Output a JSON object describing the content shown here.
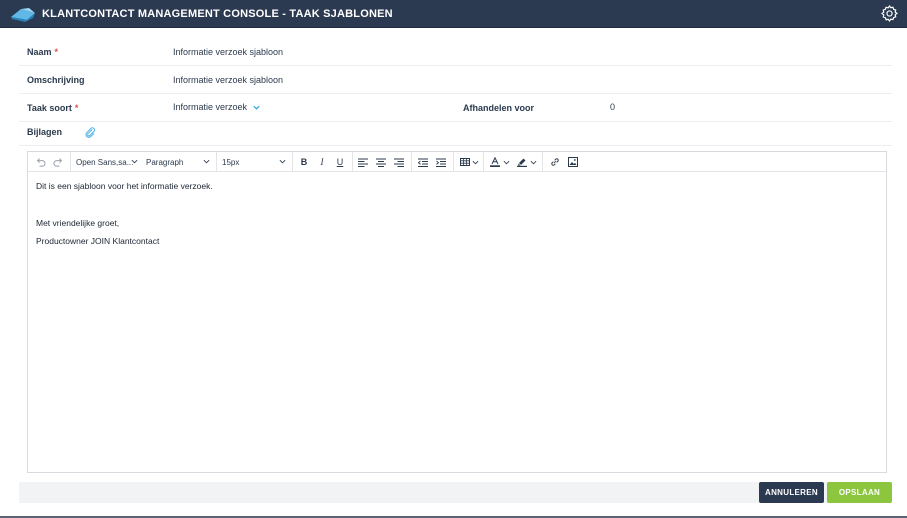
{
  "header": {
    "title": "KLANTCONTACT MANAGEMENT CONSOLE - TAAK SJABLONEN",
    "brand_color": "#2c3a51"
  },
  "form": {
    "naam": {
      "label": "Naam",
      "required_mark": "*",
      "value": "Informatie verzoek sjabloon"
    },
    "omschrijving": {
      "label": "Omschrijving",
      "value": "Informatie verzoek sjabloon"
    },
    "taak_soort": {
      "label": "Taak soort",
      "required_mark": "*",
      "value": "Informatie verzoek"
    },
    "afhandelen_voor": {
      "label": "Afhandelen voor",
      "value": "0"
    },
    "bijlagen": {
      "label": "Bijlagen"
    }
  },
  "editor": {
    "toolbar": {
      "font_family": "Open Sans,sa...",
      "block_format": "Paragraph",
      "font_size": "15px"
    },
    "content": [
      "Dit is een sjabloon voor het informatie verzoek.",
      "Met vriendelijke groet,",
      "Productowner JOIN Klantcontact"
    ]
  },
  "actions": {
    "cancel_label": "ANNULEREN",
    "save_label": "OPSLAAN",
    "cancel_color": "#2c3a51",
    "save_color": "#8cc63f"
  },
  "icons": {
    "logo": "cloud-logo-icon",
    "settings": "gear-icon",
    "attachment": "paperclip-icon"
  }
}
